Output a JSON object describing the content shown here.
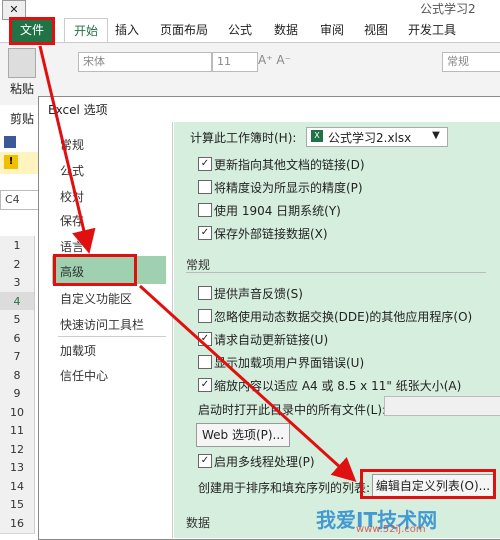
{
  "window": {
    "title": "公式学习2"
  },
  "ribbon": {
    "tabs": [
      "文件",
      "开始",
      "插入",
      "页面布局",
      "公式",
      "数据",
      "审阅",
      "视图",
      "开发工具"
    ],
    "paste_label": "粘贴",
    "clipboard_label": "剪贴",
    "font_name": "宋体",
    "font_size": "11",
    "number_format": "常规"
  },
  "sheet": {
    "name_box": "C4",
    "rows": [
      "1",
      "2",
      "3",
      "4",
      "5",
      "6",
      "7",
      "8",
      "9",
      "10",
      "11",
      "12",
      "13",
      "14",
      "15",
      "16"
    ]
  },
  "dialog": {
    "title": "Excel 选项",
    "nav": [
      "常规",
      "公式",
      "校对",
      "保存",
      "语言",
      "高级",
      "自定义功能区",
      "快速访问工具栏",
      "加载项",
      "信任中心"
    ],
    "calc_label": "计算此工作簿时(H):",
    "calc_value": "公式学习2.xlsx",
    "calc_options": [
      {
        "label": "更新指向其他文档的链接(D)",
        "checked": true
      },
      {
        "label": "将精度设为所显示的精度(P)",
        "checked": false
      },
      {
        "label": "使用 1904 日期系统(Y)",
        "checked": false
      },
      {
        "label": "保存外部链接数据(X)",
        "checked": true
      }
    ],
    "general_section": "常规",
    "general_options": [
      {
        "label": "提供声音反馈(S)",
        "checked": false
      },
      {
        "label": "忽略使用动态数据交换(DDE)的其他应用程序(O)",
        "checked": false
      },
      {
        "label": "请求自动更新链接(U)",
        "checked": true
      },
      {
        "label": "显示加载项用户界面错误(U)",
        "checked": false
      },
      {
        "label": "缩放内容以适应 A4 或 8.5 x 11\" 纸张大小(A)",
        "checked": true
      }
    ],
    "startup_label": "启动时打开此目录中的所有文件(L):",
    "web_button": "Web 选项(P)...",
    "multithread": {
      "label": "启用多线程处理(P)",
      "checked": true
    },
    "custom_list_label": "创建用于排序和填充序列的列表:",
    "edit_list_button": "编辑自定义列表(O)...",
    "data_section": "数据"
  },
  "watermark": {
    "main": "我爱IT技术网",
    "sub": "www.52ij.com"
  },
  "colors": {
    "excel_green": "#217346",
    "highlight": "#9fd0b0",
    "panel": "#d6eedd",
    "annotation_red": "#e01010"
  }
}
